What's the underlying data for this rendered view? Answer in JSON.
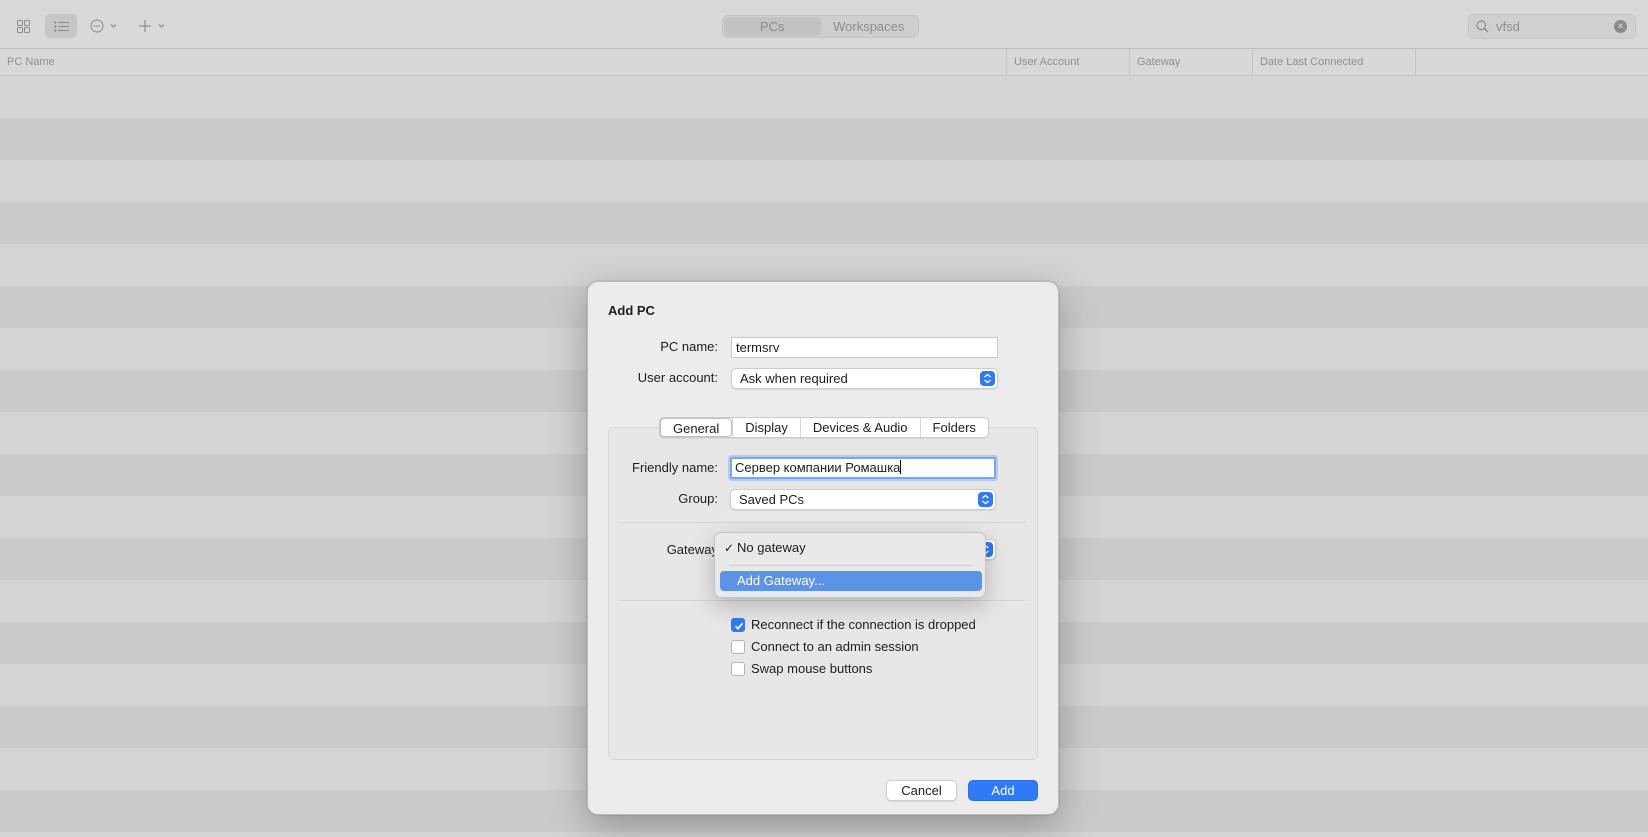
{
  "toolbar": {
    "icons": [
      "grid-view-icon",
      "list-view-icon",
      "more-icon",
      "add-icon"
    ],
    "segments": [
      "PCs",
      "Workspaces"
    ],
    "selected_segment": "PCs",
    "search_value": "vfsd"
  },
  "table": {
    "columns": [
      "PC Name",
      "User Account",
      "Gateway",
      "Date Last Connected"
    ]
  },
  "dialog": {
    "title": "Add PC",
    "pc_name_label": "PC name:",
    "pc_name_value": "termsrv",
    "user_account_label": "User account:",
    "user_account_value": "Ask when required",
    "tabs": [
      "General",
      "Display",
      "Devices & Audio",
      "Folders"
    ],
    "selected_tab": "General",
    "friendly_name_label": "Friendly name:",
    "friendly_name_value": "Сервер компании Ромашка",
    "group_label": "Group:",
    "group_value": "Saved PCs",
    "gateway_label": "Gateway",
    "checkboxes": [
      {
        "label": "Reconnect if the connection is dropped",
        "checked": true
      },
      {
        "label": "Connect to an admin session",
        "checked": false
      },
      {
        "label": "Swap mouse buttons",
        "checked": false
      }
    ],
    "cancel_label": "Cancel",
    "add_label": "Add"
  },
  "gateway_menu": {
    "items": [
      {
        "label": "No gateway",
        "checked": true
      },
      {
        "label": "Add Gateway...",
        "highlighted": true
      }
    ]
  },
  "colors": {
    "accent": "#2f7bf5",
    "menu_highlight": "#5a93e8"
  }
}
